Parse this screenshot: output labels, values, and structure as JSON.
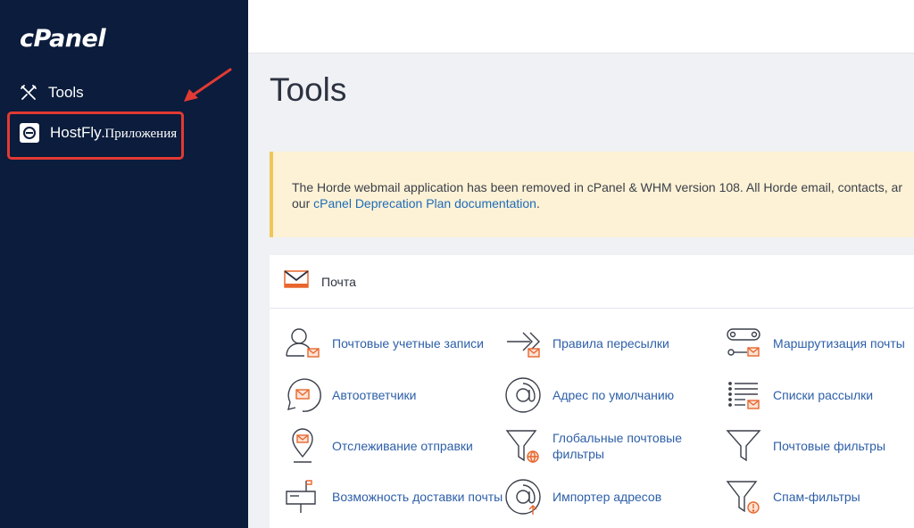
{
  "sidebar": {
    "logo": "cPanel",
    "items": [
      {
        "label": "Tools",
        "icon": "tools-icon"
      },
      {
        "label": "HostFly",
        "suffix": ".Приложения",
        "icon": "hostfly-icon"
      }
    ],
    "highlight_color": "#e23a33"
  },
  "main": {
    "title": "Tools",
    "notice": {
      "text_part1": "The Horde webmail application has been removed in cPanel & WHM version 108. All Horde email, contacts, ar",
      "text_part2": "our ",
      "link": "cPanel Deprecation Plan documentation",
      "text_part3": "."
    },
    "mail_section": {
      "title": "Почта",
      "items": [
        {
          "label": "Почтовые учетные записи",
          "icon": "email-accounts-icon"
        },
        {
          "label": "Правила пересылки",
          "icon": "forwarders-icon"
        },
        {
          "label": "Маршрутизация почты",
          "icon": "email-routing-icon"
        },
        {
          "label": "Автоответчики",
          "icon": "autoresponders-icon"
        },
        {
          "label": "Адрес по умолчанию",
          "icon": "default-address-icon"
        },
        {
          "label": "Списки рассылки",
          "icon": "mailing-lists-icon"
        },
        {
          "label": "Отслеживание отправки",
          "icon": "track-delivery-icon"
        },
        {
          "label": "Глобальные почтовые фильтры",
          "icon": "global-filters-icon"
        },
        {
          "label": "Почтовые фильтры",
          "icon": "email-filters-icon"
        },
        {
          "label": "Возможность доставки почты",
          "icon": "deliverability-icon"
        },
        {
          "label": "Импортер адресов",
          "icon": "address-importer-icon"
        },
        {
          "label": "Спам-фильтры",
          "icon": "spam-filters-icon"
        }
      ]
    }
  },
  "colors": {
    "sidebar_bg": "#0b1c3c",
    "link": "#2d5fa8",
    "accent_orange": "#e8662d",
    "notice_bg": "#fdf2d5"
  }
}
